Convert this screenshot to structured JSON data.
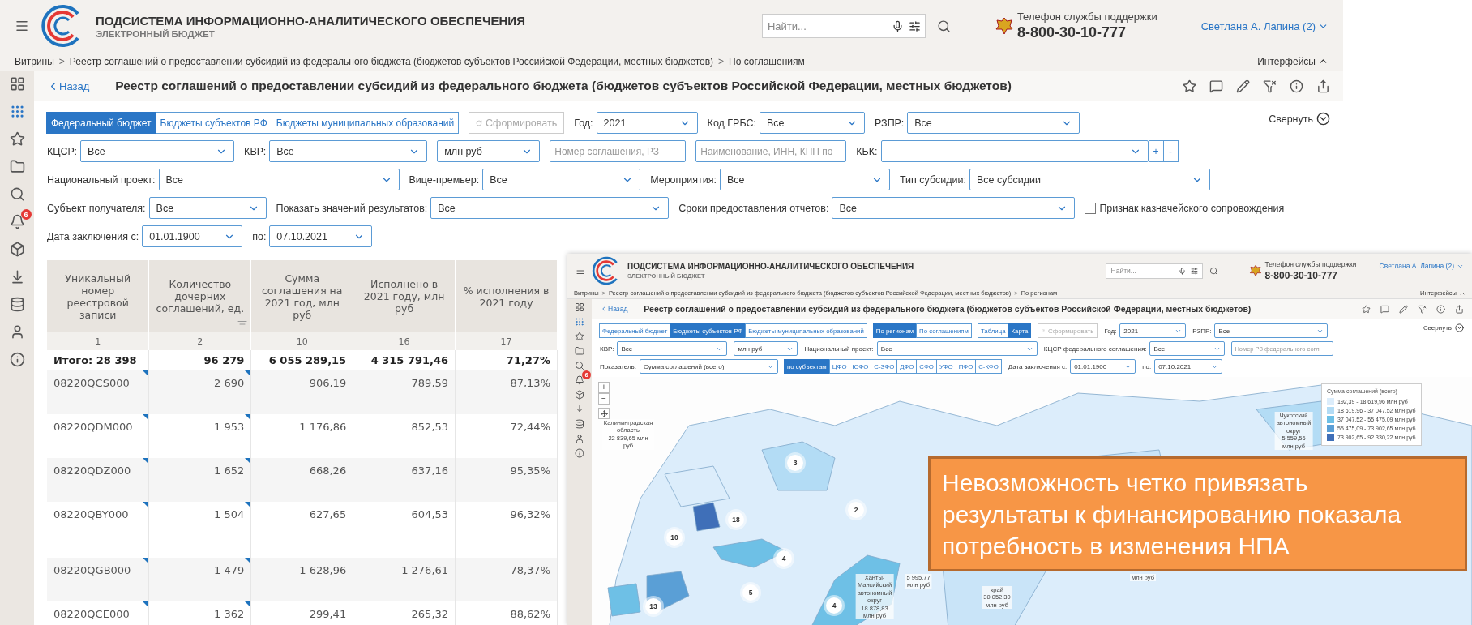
{
  "main": {
    "header": {
      "title": "ПОДСИСТЕМА ИНФОРМАЦИОННО-АНАЛИТИЧЕСКОГО ОБЕСПЕЧЕНИЯ",
      "subtitle": "ЭЛЕКТРОННЫЙ БЮДЖЕТ",
      "search": {
        "placeholder": "Найти..."
      },
      "support_label": "Телефон службы поддержки",
      "phone": "8-800-30-10-777",
      "user": "Светлана А. Лапина (2)"
    },
    "breadcrumbs": [
      {
        "label": "Витрины"
      },
      {
        "separator": ">",
        "label": "Реестр соглашений о предоставлении субсидий из федерального бюджета (бюджетов субъектов Российской Федерации, местных бюджетов)"
      },
      {
        "separator": ">",
        "label": "По соглашениям"
      }
    ],
    "interfaces": "Интерфейсы",
    "sidebar": [
      {
        "kind": "grid",
        "selected": false
      },
      {
        "kind": "apps",
        "selected": true
      },
      {
        "kind": "star",
        "selected": false
      },
      {
        "kind": "folder",
        "selected": false
      },
      {
        "kind": "search",
        "selected": false
      },
      {
        "kind": "bell",
        "selected": false,
        "badge": "6"
      },
      {
        "kind": "cube",
        "selected": false
      },
      {
        "kind": "download",
        "selected": false
      },
      {
        "kind": "database",
        "selected": false
      },
      {
        "kind": "user",
        "selected": false
      },
      {
        "kind": "info",
        "selected": false
      }
    ],
    "back": "Назад",
    "title": "Реестр соглашений о предоставлении субсидий из федерального бюджета (бюджетов субъектов Российской Федерации, местных бюджетов)",
    "collapse": "Свернуть",
    "filter_rows": [
      [
        {
          "kind": "tabs",
          "tabs": [
            {
              "label": "Федеральный бюджет",
              "selected": true
            },
            {
              "label": "Бюджеты субъектов РФ",
              "selected": false
            },
            {
              "label": "Бюджеты муниципальных образований",
              "selected": false
            }
          ]
        },
        {
          "kind": "button",
          "label": "Сформировать",
          "disabled": true
        },
        {
          "kind": "select",
          "label": "Год:",
          "value": "2021"
        },
        {
          "kind": "select",
          "label": "Код ГРБС:",
          "value": "Все"
        },
        {
          "kind": "select",
          "label": "РЗПР:",
          "value": "Все"
        }
      ],
      [
        {
          "kind": "select",
          "label": "КЦСР:",
          "value": "Все"
        },
        {
          "kind": "select",
          "label": "КВР:",
          "value": "Все"
        },
        {
          "kind": "select",
          "value": "млн руб"
        },
        {
          "kind": "input",
          "placeholder": "Номер соглашения, РЗ"
        },
        {
          "kind": "input",
          "placeholder": "Наименование, ИНН, КПП по"
        },
        {
          "kind": "select",
          "label": "КБК:"
        },
        {
          "kind": "stepper",
          "buttons": [
            "+",
            "-"
          ]
        }
      ],
      [
        {
          "kind": "select",
          "label": "Национальный проект:",
          "value": "Все"
        },
        {
          "kind": "select",
          "label": "Вице-премьер:",
          "value": "Все"
        },
        {
          "kind": "select",
          "label": "Мероприятия:",
          "value": "Все"
        },
        {
          "kind": "select",
          "label": "Тип субсидии:",
          "value": "Все субсидии"
        }
      ],
      [
        {
          "kind": "select",
          "label": "Субъект получателя:",
          "value": "Все"
        },
        {
          "kind": "select",
          "label": "Показать значений результатов:",
          "value": "Все"
        },
        {
          "kind": "select",
          "label": "Сроки предоставления отчетов:",
          "value": "Все"
        },
        {
          "kind": "checkbox",
          "label": "Признак казначейского сопровождения",
          "checked": false
        }
      ],
      [
        {
          "kind": "select",
          "label": "Дата заключения с:",
          "value": "01.01.1900"
        },
        {
          "kind": "select",
          "label": "по:",
          "value": "07.10.2021"
        }
      ]
    ],
    "table": {
      "columns": [
        {
          "title": "Уникальный номер реестровой записи",
          "number": "1"
        },
        {
          "title": "Количество дочерних соглашений, ед.",
          "number": "2"
        },
        {
          "title": "Сумма соглашения на 2021 год, млн руб",
          "number": "10"
        },
        {
          "title": "Исполнено в 2021 году, млн руб",
          "number": "16"
        },
        {
          "title": "% исполнения в 2021 году",
          "number": "17"
        }
      ],
      "total": [
        "Итого: 28 398",
        "96 279",
        "6 055 289,15",
        "4 315 791,46",
        "71,27%"
      ],
      "rows": [
        [
          "08220QCS000",
          "2 690",
          "906,19",
          "789,59",
          "87,13%"
        ],
        [
          "08220QDM000",
          "1 953",
          "1 176,86",
          "852,53",
          "72,44%"
        ],
        [
          "08220QDZ000",
          "1 652",
          "668,26",
          "637,16",
          "95,35%"
        ],
        [
          "08220QBY000",
          "1 504",
          "627,65",
          "604,53",
          "96,32%"
        ],
        [
          "08220QGB000",
          "1 479",
          "1 628,96",
          "1 276,61",
          "78,37%"
        ],
        [
          "08220QCE000",
          "1 362",
          "299,41",
          "265,32",
          "88,62%"
        ]
      ]
    }
  },
  "inset": {
    "header": {
      "title": "ПОДСИСТЕМА ИНФОРМАЦИОННО-АНАЛИТИЧЕСКОГО ОБЕСПЕЧЕНИЯ",
      "subtitle": "ЭЛЕКТРОННЫЙ БЮДЖЕТ",
      "search": {
        "placeholder": "Найти..."
      },
      "support_label": "Телефон службы поддержки",
      "phone": "8-800-30-10-777",
      "user": "Светлана А. Лапина (2)"
    },
    "breadcrumbs": [
      {
        "label": "Витрины"
      },
      {
        "separator": ">",
        "label": "Реестр соглашений о предоставлении субсидий из федерального бюджета (бюджетов субъектов Российской Федерации, местных бюджетов)"
      },
      {
        "separator": ">",
        "label": "По регионам"
      }
    ],
    "interfaces": "Интерфейсы",
    "sidebar": [
      {
        "kind": "grid",
        "selected": false
      },
      {
        "kind": "apps",
        "selected": true
      },
      {
        "kind": "star",
        "selected": false
      },
      {
        "kind": "folder",
        "selected": false
      },
      {
        "kind": "search",
        "selected": false
      },
      {
        "kind": "bell",
        "selected": false,
        "badge": "6"
      },
      {
        "kind": "cube",
        "selected": false
      },
      {
        "kind": "download",
        "selected": false
      },
      {
        "kind": "database",
        "selected": false
      },
      {
        "kind": "user",
        "selected": false
      },
      {
        "kind": "info",
        "selected": false
      }
    ],
    "back": "Назад",
    "title": "Реестр соглашений о предоставлении субсидий из федерального бюджета (бюджетов субъектов Российской Федерации, местных бюджетов)",
    "collapse": "Свернуть",
    "filter_rows": [
      [
        {
          "kind": "tabs",
          "tabs": [
            {
              "label": "Федеральный бюджет",
              "selected": false
            },
            {
              "label": "Бюджеты субъектов РФ",
              "selected": true
            },
            {
              "label": "Бюджеты муниципальных образований",
              "selected": false
            }
          ]
        },
        {
          "kind": "tabs",
          "tabs": [
            {
              "label": "По регионам",
              "selected": true
            },
            {
              "label": "По соглашениям",
              "selected": false
            }
          ]
        },
        {
          "kind": "tabs",
          "tabs": [
            {
              "label": "Таблица",
              "selected": false
            },
            {
              "label": "Карта",
              "selected": true
            }
          ]
        },
        {
          "kind": "button",
          "label": "Сформировать",
          "disabled": true
        },
        {
          "kind": "select",
          "label": "Год:",
          "value": "2021"
        },
        {
          "kind": "select",
          "label": "РЗПР:",
          "value": "Все"
        }
      ],
      [
        {
          "kind": "select",
          "label": "КВР:",
          "value": "Все"
        },
        {
          "kind": "select",
          "value": "млн руб"
        },
        {
          "kind": "select",
          "label": "Национальный проект:",
          "value": "Все"
        },
        {
          "kind": "select",
          "label": "КЦСР федерального соглашения:",
          "value": "Все"
        },
        {
          "kind": "input",
          "placeholder": "Номер РЗ федерального согл"
        }
      ],
      [
        {
          "kind": "select",
          "label": "Показатель:",
          "value": "Сумма соглашений (всего)"
        },
        {
          "kind": "tabs",
          "tabs": [
            {
              "label": "по субъектам",
              "selected": true
            },
            {
              "label": "ЦФО",
              "selected": false
            },
            {
              "label": "ЮФО",
              "selected": false
            },
            {
              "label": "С-ЗФО",
              "selected": false
            },
            {
              "label": "ДФО",
              "selected": false
            },
            {
              "label": "СФО",
              "selected": false
            },
            {
              "label": "УФО",
              "selected": false
            },
            {
              "label": "ПФО",
              "selected": false
            },
            {
              "label": "С-КФО",
              "selected": false
            }
          ]
        },
        {
          "kind": "select",
          "label": "Дата заключения с:",
          "value": "01.01.1900"
        },
        {
          "kind": "select",
          "label": "по:",
          "value": "07.10.2021"
        }
      ]
    ],
    "map": {
      "zoom": [
        "+",
        "−"
      ],
      "region_labels": [
        {
          "lines": [
            "Калининградская",
            "область",
            "22 839,65 млн",
            "руб"
          ]
        },
        {
          "lines": [
            "Чукотский",
            "автономный",
            "округ",
            "5 559,56",
            "млн руб"
          ]
        },
        {
          "lines": [
            "Ханты-",
            "Мансийский",
            "автономный",
            "округ",
            "18 878,83",
            "млн руб"
          ]
        },
        {
          "lines": [
            "5 995,77",
            "млн руб"
          ]
        },
        {
          "lines": [
            "край",
            "30 052,30",
            "млн руб"
          ]
        },
        {
          "lines": [
            "млн руб"
          ]
        }
      ],
      "clusters": [
        "3",
        "2",
        "18",
        "10",
        "4",
        "5",
        "13",
        "4"
      ],
      "legend": {
        "title": "Сумма соглашений (всего)",
        "items": [
          {
            "label": "192,39 - 18 619,96 млн руб",
            "color": "#dcedfb"
          },
          {
            "label": "18 619,96 - 37 047,52 млн руб",
            "color": "#b3dcf5"
          },
          {
            "label": "37 047,52 - 55 475,09 млн руб",
            "color": "#6ec0e6"
          },
          {
            "label": "55 475,09 - 73 902,65 млн руб",
            "color": "#5a9fd6"
          },
          {
            "label": "73 902,65 - 92 330,22 млн руб",
            "color": "#3f6fb8"
          }
        ]
      }
    }
  },
  "callout": "Невозможность четко привязать результаты к финансированию показала потребность в изменения НПА"
}
